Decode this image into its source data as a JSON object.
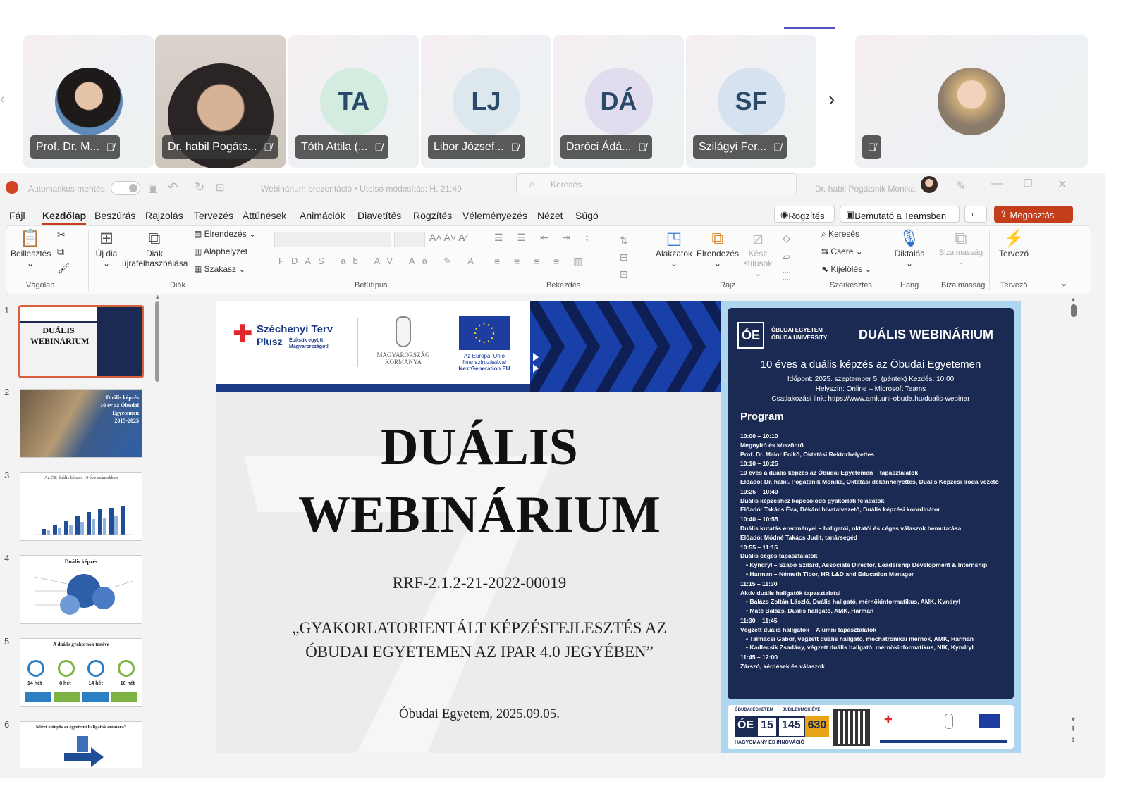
{
  "participants": [
    {
      "name": "Prof. Dr. M...",
      "initials": "",
      "photo": true
    },
    {
      "name": "Dr. habil Pogáts...",
      "initials": "",
      "photo": true
    },
    {
      "name": "Tóth Attila (...",
      "initials": "TA",
      "color": "#d3ecdf"
    },
    {
      "name": "Libor József...",
      "initials": "LJ",
      "color": "#dde8ee"
    },
    {
      "name": "Daróci Ádá...",
      "initials": "DÁ",
      "color": "#e2dcef"
    },
    {
      "name": "Szilágyi Fer...",
      "initials": "SF",
      "color": "#d6e2f0"
    },
    {
      "name": "",
      "initials": "",
      "photo": true
    }
  ],
  "titlebar": {
    "autosave": "Automatikus mentés",
    "doc": "Webinárium prezentáció • Utolsó módosítás: H, 21:49",
    "search": "Keresés",
    "user": "Dr. habil Pogátsnik Monika"
  },
  "menu": [
    "Fájl",
    "Kezdőlap",
    "Beszúrás",
    "Rajzolás",
    "Tervezés",
    "Áttűnések",
    "Animációk",
    "Diavetítés",
    "Rögzítés",
    "Véleményezés",
    "Nézet",
    "Súgó"
  ],
  "actions": {
    "record": "Rögzítés",
    "present": "Bemutató a Teamsben",
    "share": "Megosztás"
  },
  "ribbon": {
    "paste": "Beillesztés",
    "new_slide": "Új dia",
    "reuse": "Diák újrafelhasználása",
    "layout": "Elrendezés",
    "reset": "Alaphelyzet",
    "section": "Szakasz",
    "shapes": "Alakzatok",
    "arrange": "Elrendezés",
    "styles": "Kész stílusok",
    "find": "Keresés",
    "replace": "Csere",
    "select": "Kijelölés",
    "dictate": "Diktálás",
    "sensitivity": "Bizalmasság",
    "designer": "Tervező",
    "groups": {
      "clipboard": "Vágólap",
      "slides": "Diák",
      "font": "Betűtípus",
      "paragraph": "Bekezdés",
      "drawing": "Rajz",
      "editing": "Szerkesztés",
      "voice": "Hang",
      "sensitivity": "Bizalmasság",
      "designer": "Tervező"
    }
  },
  "thumbs": [
    {
      "num": "1",
      "text": "DUÁLIS WEBINÁRIUM"
    },
    {
      "num": "2",
      "text": "Duális képzés 10 év az Óbudai Egyetemen 2015-2025"
    },
    {
      "num": "3",
      "text": "Az ÓE duális képzés 10 éve számokban"
    },
    {
      "num": "4",
      "text": "Duális képzés"
    },
    {
      "num": "5",
      "text": "A duális gyakornok tanéve"
    },
    {
      "num": "6",
      "text": "Miért előnyös az egyetemi hallgatók számára?"
    }
  ],
  "thumb5": [
    "14 hét",
    "8 hét",
    "14 hét",
    "16 hét"
  ],
  "slide": {
    "logo1": "Széchenyi Terv",
    "logo2": "Plusz",
    "logo_sub": "Építsük együtt Magyarországot!",
    "gov": "MAGYARORSZÁG KORMÁNYA",
    "eu": "Az Európai Unió finanszírozásával",
    "eu2": "NextGeneration EU",
    "title1": "DUÁLIS",
    "title2": "WEBINÁRIUM",
    "code": "RRF-2.1.2-21-2022-00019",
    "quote1": "„GYAKORLATORIENTÁLT KÉPZÉSFEJLESZTÉS AZ",
    "quote2": "ÓBUDAI EGYETEMEN AZ IPAR 4.0 JEGYÉBEN”",
    "footer": "Óbudai Egyetem, 2025.09.05."
  },
  "poster": {
    "oe": "ÓE",
    "uni1": "ÓBUDAI EGYETEM",
    "uni2": "ÓBUDA UNIVERSITY",
    "head": "DUÁLIS WEBINÁRIUM",
    "sub": "10 éves a duális képzés az Óbudai Egyetemen",
    "info1": "Időpont: 2025. szeptember 5. (péntek)   Kezdés: 10:00",
    "info2": "Helyszín: Online – Microsoft Teams",
    "info3": "Csatlakozási link: https://www.amk.uni-obuda.hu/dualis-webinar",
    "program": "Program",
    "items": [
      [
        "10:00 – 10:10",
        "Megnyitó és köszöntő",
        "Prof. Dr. Maior Enikő, Oktatási Rektorhelyettes"
      ],
      [
        "10:10 – 10:25",
        "10 éves a duális képzés az Óbudai Egyetemen – tapasztalatok",
        "Előadó: Dr. habil. Pogátsnik Monika, Oktatási dékánhelyettes, Duális Képzési Iroda vezető"
      ],
      [
        "10:25 – 10:40",
        "Duális képzéshez kapcsolódó gyakorlati feladatok",
        "Előadó: Takács Éva, Dékáni hivatalvezető, Duális képzési koordinátor"
      ],
      [
        "10:40 – 10:55",
        "Duális kutatás eredményei – hallgatói, oktatói és céges válaszok bemutatása",
        "Előadó: Módné Takács Judit, tanársegéd"
      ],
      [
        "10:55 – 11:15",
        "Duális céges tapasztalatok",
        "• Kyndryl – Szabó Szilárd, Associate Director, Leadership Development & Internship",
        "• Harman – Németh Tibor, HR L&D and Education Manager"
      ],
      [
        "11:15 – 11:30",
        "Aktív duális hallgatók tapasztalatai",
        "• Balázs Zoltán László, Duális hallgató, mérnökinformatikus, AMK, Kyndryl",
        "• Máté Balázs, Duális hallgató, AMK, Harman"
      ],
      [
        "11:30 – 11:45",
        "Végzett duális hallgatók – Alumni tapasztalatok",
        "• Talmácsi Gábor, végzett duális hallgató, mechatronikai mérnök, AMK, Harman",
        "• Kadlecsik Zsadány, végzett duális hallgató, mérnökinformatikus, NIK, Kyndryl"
      ],
      [
        "11:45 – 12:00",
        "Zárszó, kérdések és válaszok"
      ]
    ],
    "foot_uni": "ÓBUDAI EGYETEM",
    "foot_jub": "JUBILEUMOK ÉVE",
    "foot_n1": "15",
    "foot_n2": "145",
    "foot_n3": "630",
    "foot_motto": "HAGYOMÁNY ÉS INNOVÁCIÓ"
  }
}
